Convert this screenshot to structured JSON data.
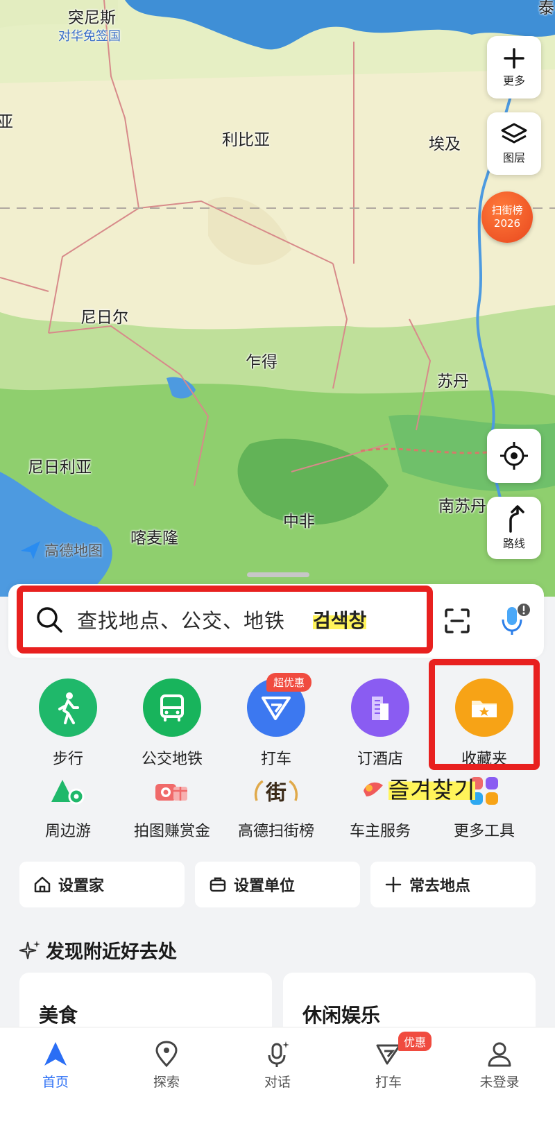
{
  "map": {
    "labels": {
      "tunisia": "突尼斯",
      "tunisia_visa": "对华免签国",
      "libya": "利比亚",
      "egypt": "埃及",
      "niger": "尼日尔",
      "chad": "乍得",
      "sudan": "苏丹",
      "nigeria": "尼日利亚",
      "cameroon": "喀麦隆",
      "car": "中非",
      "south_sudan": "南苏丹",
      "edge_top_right": "泰",
      "edge_left": "亚"
    },
    "buttons": {
      "more": "更多",
      "layers": "图层",
      "route": "路线"
    },
    "rank_badge": {
      "line1": "扫街榜",
      "line2": "2026"
    },
    "logo_text": "高德地图"
  },
  "search": {
    "placeholder": "查找地点、公交、地铁",
    "annotation": "검색창"
  },
  "services": {
    "walk": "步行",
    "bus": "公交地铁",
    "taxi": "打车",
    "taxi_promo": "超优惠",
    "hotel": "订酒店",
    "favorites": "收藏夹",
    "nearby_tour": "周边游",
    "photo_reward": "拍图赚赏金",
    "rank": "高德扫街榜",
    "car_owner": "车主服务",
    "more_tools": "更多工具",
    "favorites_annotation": "즐겨찾기"
  },
  "quick": {
    "home": "设置家",
    "work": "设置单位",
    "frequent": "常去地点"
  },
  "discover": {
    "title": "发现附近好去处",
    "cards": [
      "美食",
      "休闲娱乐"
    ]
  },
  "tabs": {
    "home": "首页",
    "explore": "探索",
    "chat": "对话",
    "taxi": "打车",
    "taxi_badge": "优惠",
    "profile": "未登录"
  },
  "colors": {
    "accent": "#2a6ef5",
    "highlight_red": "#e8201f",
    "walk_green": "#1fb86a",
    "bus_green": "#18b45c",
    "taxi_blue": "#3c78f0",
    "hotel_purple": "#8a5cf2",
    "favorites_orange": "#f7a316"
  }
}
